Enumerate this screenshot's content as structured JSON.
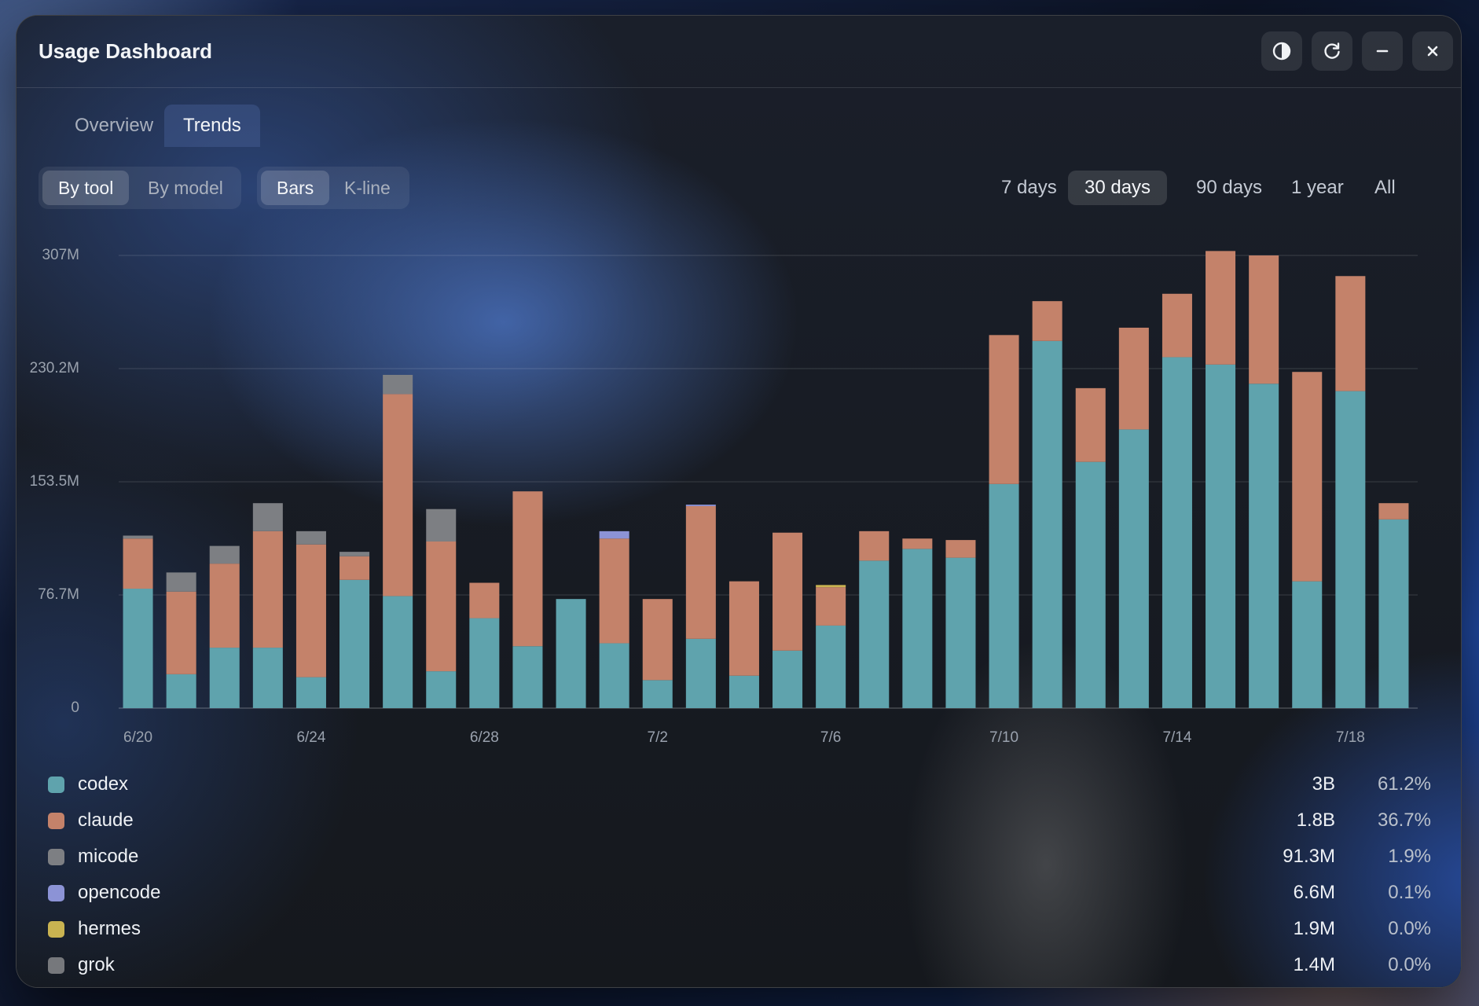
{
  "window": {
    "title": "Usage Dashboard"
  },
  "controls": {
    "theme_icon": "contrast-icon",
    "refresh_icon": "refresh-icon",
    "minimize_icon": "minimize-icon",
    "close_icon": "close-icon"
  },
  "tabs": [
    {
      "label": "Overview",
      "active": false
    },
    {
      "label": "Trends",
      "active": true
    }
  ],
  "group_toggle": [
    {
      "label": "By tool",
      "active": true
    },
    {
      "label": "By model",
      "active": false
    }
  ],
  "view_toggle": [
    {
      "label": "Bars",
      "active": true
    },
    {
      "label": "K-line",
      "active": false
    }
  ],
  "ranges": [
    {
      "label": "7 days",
      "active": false
    },
    {
      "label": "30 days",
      "active": true
    },
    {
      "label": "90 days",
      "active": false
    },
    {
      "label": "1 year",
      "active": false
    },
    {
      "label": "All",
      "active": false
    }
  ],
  "colors": {
    "codex": "#5fa3ad",
    "claude": "#c4826a",
    "micode": "#7d7f83",
    "opencode": "#8c93d6",
    "hermes": "#c9b351",
    "grok": "#76787c"
  },
  "chart_data": {
    "type": "bar",
    "stacked": true,
    "y_ticks": [
      "0",
      "76.7M",
      "153.5M",
      "230.2M",
      "307M"
    ],
    "ylim": [
      0,
      307
    ],
    "y_unit": "M",
    "categories": [
      "6/20",
      "6/21",
      "6/22",
      "6/23",
      "6/24",
      "6/25",
      "6/26",
      "6/27",
      "6/28",
      "6/29",
      "6/30",
      "7/1",
      "7/2",
      "7/3",
      "7/4",
      "7/5",
      "7/6",
      "7/7",
      "7/8",
      "7/9",
      "7/10",
      "7/11",
      "7/12",
      "7/13",
      "7/14",
      "7/15",
      "7/16",
      "7/17",
      "7/18",
      "7/19"
    ],
    "x_tick_labels": [
      "6/20",
      "6/24",
      "6/28",
      "7/2",
      "7/6",
      "7/10",
      "7/14",
      "7/18"
    ],
    "series": [
      {
        "name": "codex",
        "values": [
          81,
          23,
          41,
          41,
          21,
          87,
          76,
          25,
          61,
          42,
          74,
          44,
          19,
          47,
          22,
          39,
          56,
          100,
          108,
          102,
          152,
          249,
          167,
          189,
          238,
          233,
          220,
          86,
          215,
          128
        ]
      },
      {
        "name": "claude",
        "values": [
          34,
          56,
          57,
          79,
          90,
          16,
          137,
          88,
          24,
          105,
          0,
          71,
          55,
          90,
          64,
          80,
          26,
          20,
          7,
          12,
          101,
          27,
          50,
          69,
          43,
          77,
          87,
          142,
          78,
          11
        ]
      },
      {
        "name": "micode",
        "values": [
          2,
          13,
          12,
          19,
          9,
          3,
          13,
          22,
          0,
          0,
          0,
          0,
          0,
          0,
          0,
          0,
          0,
          0,
          0,
          0,
          0,
          0,
          0,
          0,
          0,
          0,
          0,
          0,
          0,
          0
        ]
      },
      {
        "name": "opencode",
        "values": [
          0,
          0,
          0,
          0,
          0,
          0,
          0,
          0,
          0,
          0,
          0,
          5,
          0,
          1,
          0,
          0,
          0,
          0,
          0,
          0,
          0,
          0,
          0,
          0,
          0,
          0,
          0,
          0,
          0,
          0
        ]
      },
      {
        "name": "hermes",
        "values": [
          0,
          0,
          0,
          0,
          0,
          0,
          0,
          0,
          0,
          0,
          0,
          0,
          0,
          0,
          0,
          0,
          1.5,
          0,
          0,
          0,
          0,
          0,
          0,
          0,
          0,
          0,
          0,
          0,
          0,
          0
        ]
      },
      {
        "name": "grok",
        "values": [
          0,
          0,
          0,
          0,
          0,
          0,
          0,
          0,
          0,
          0,
          0,
          0,
          0,
          0,
          0,
          0,
          0,
          0,
          0,
          0,
          0,
          0,
          0,
          0,
          0,
          0,
          0,
          0,
          0,
          0
        ]
      }
    ],
    "grid": true
  },
  "legend": [
    {
      "name": "codex",
      "total": "3B",
      "pct": "61.2%"
    },
    {
      "name": "claude",
      "total": "1.8B",
      "pct": "36.7%"
    },
    {
      "name": "micode",
      "total": "91.3M",
      "pct": "1.9%"
    },
    {
      "name": "opencode",
      "total": "6.6M",
      "pct": "0.1%"
    },
    {
      "name": "hermes",
      "total": "1.9M",
      "pct": "0.0%"
    },
    {
      "name": "grok",
      "total": "1.4M",
      "pct": "0.0%"
    }
  ]
}
